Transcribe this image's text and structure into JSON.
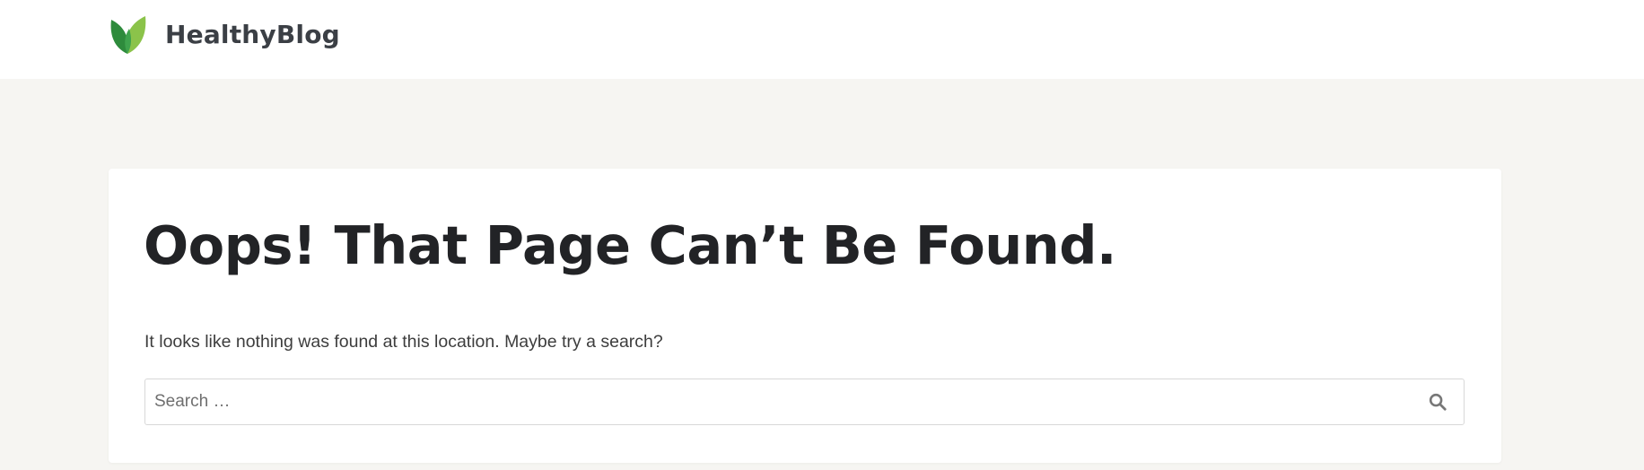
{
  "header": {
    "brand_name": "HealthyBlog",
    "logo_icon": "leaf-logo-icon",
    "colors": {
      "logo_leaf_light": "#8bc34a",
      "logo_leaf_dark": "#2e8b3c",
      "logo_leaf_mid": "#4caf50"
    }
  },
  "main": {
    "title": "Oops! That Page Can’t Be Found.",
    "message": "It looks like nothing was found at this location. Maybe try a search?",
    "search": {
      "placeholder": "Search …",
      "value": "",
      "submit_icon": "search-icon"
    }
  },
  "colors": {
    "page_background": "#f6f5f2",
    "card_background": "#ffffff",
    "title_text": "#222326",
    "body_text": "#3d3d3d",
    "input_border": "#d8d8d8",
    "icon": "#777777"
  }
}
